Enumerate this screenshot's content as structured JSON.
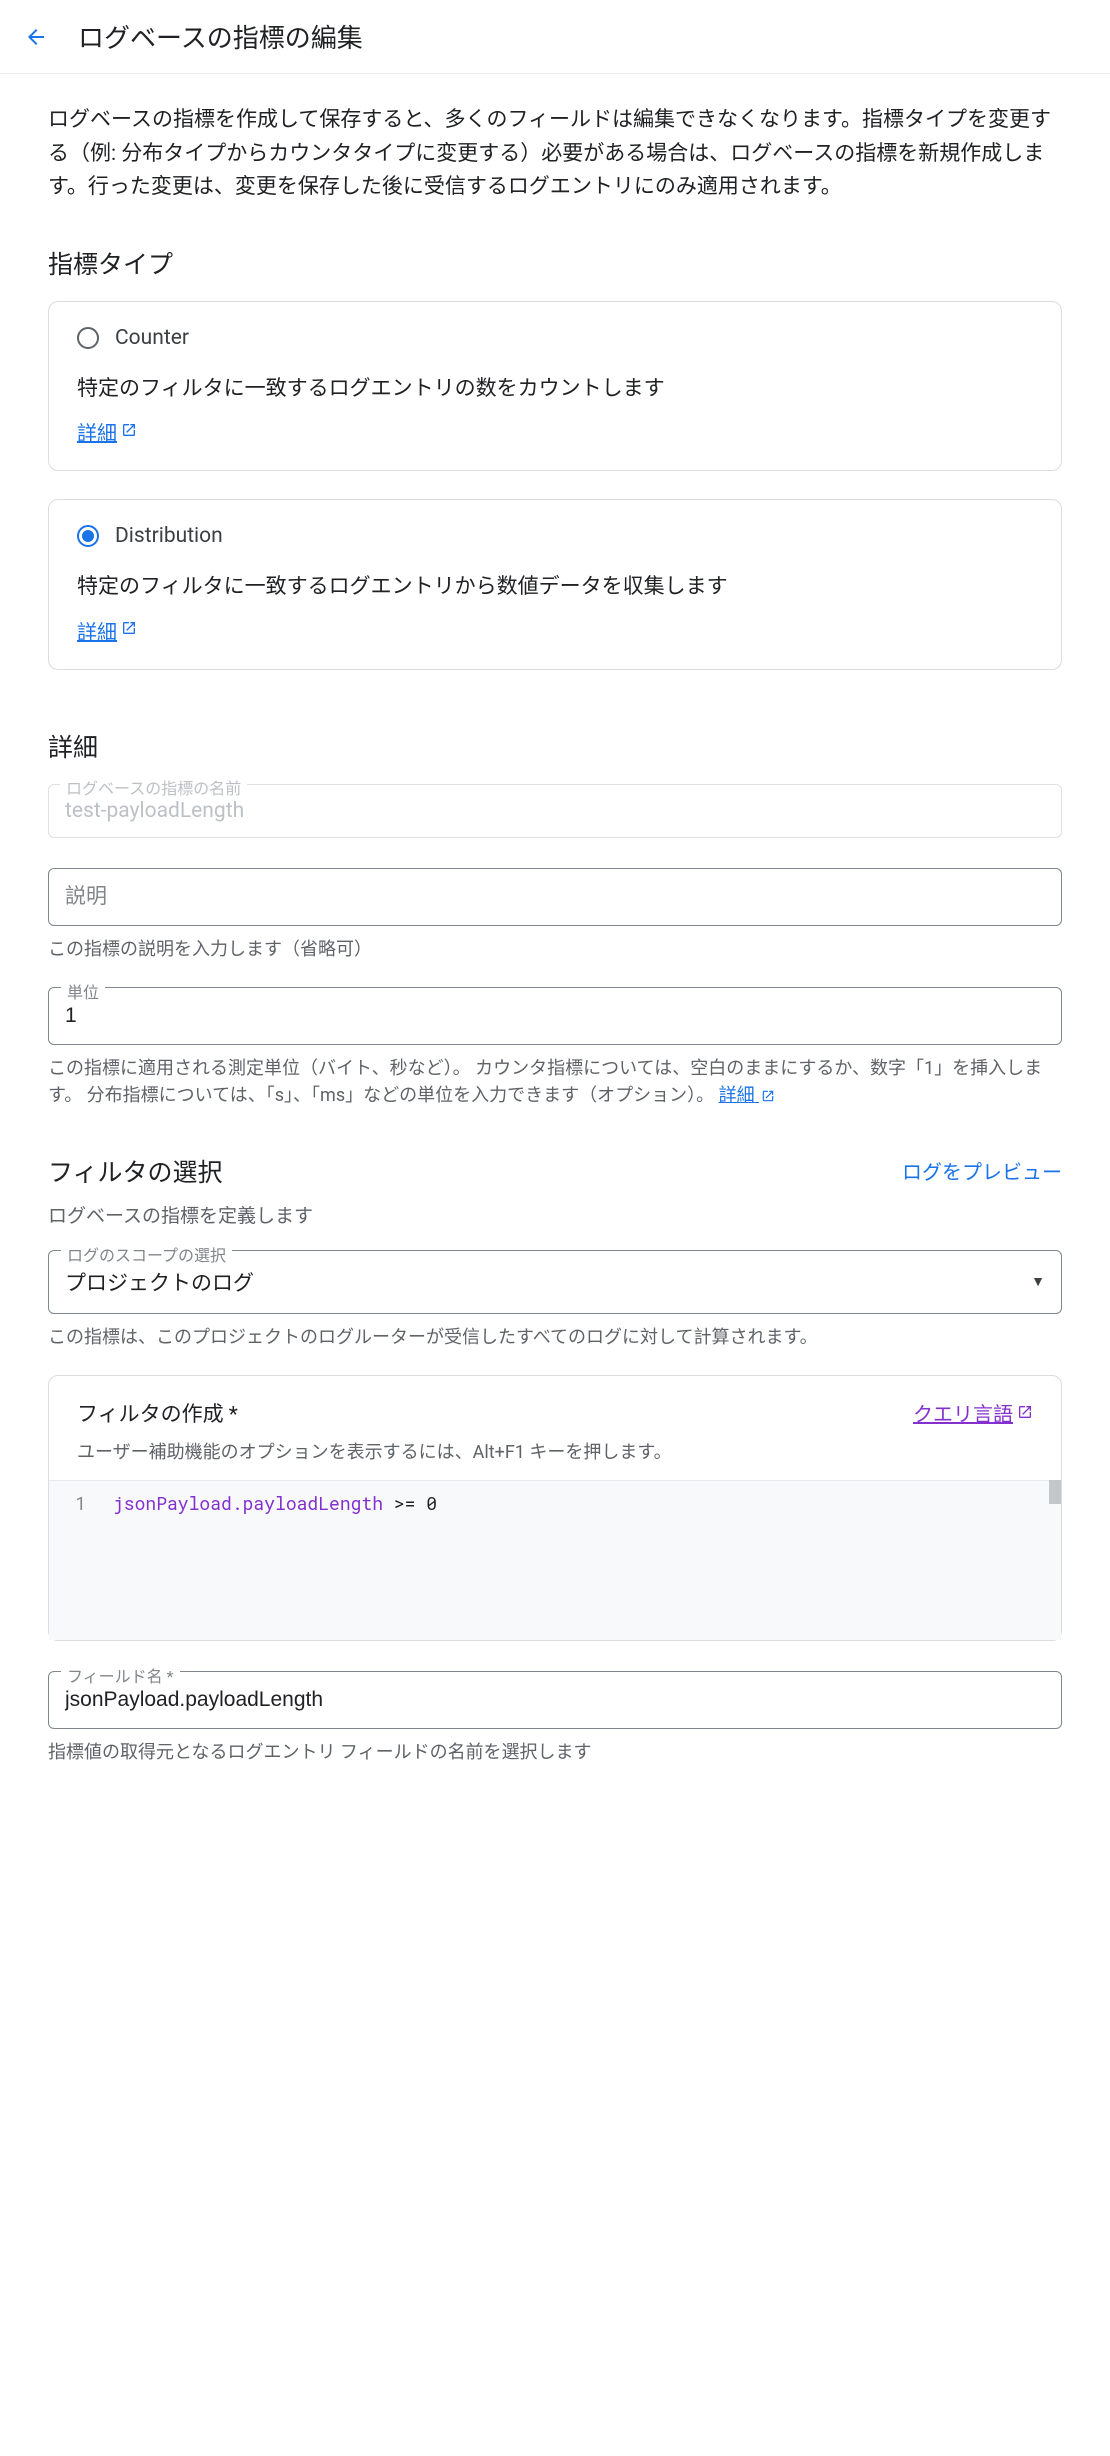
{
  "header": {
    "title": "ログベースの指標の編集"
  },
  "intro": "ログベースの指標を作成して保存すると、多くのフィールドは編集できなくなります。指標タイプを変更する（例: 分布タイプからカウンタタイプに変更する）必要がある場合は、ログベースの指標を新規作成します。行った変更は、変更を保存した後に受信するログエントリにのみ適用されます。",
  "metricType": {
    "heading": "指標タイプ",
    "counter": {
      "label": "Counter",
      "description": "特定のフィルタに一致するログエントリの数をカウントします",
      "detailLink": "詳細"
    },
    "distribution": {
      "label": "Distribution",
      "description": "特定のフィルタに一致するログエントリから数値データを収集します",
      "detailLink": "詳細"
    }
  },
  "details": {
    "heading": "詳細",
    "name": {
      "label": "ログベースの指標の名前",
      "value": "test-payloadLength"
    },
    "description": {
      "placeholder": "説明",
      "help": "この指標の説明を入力します（省略可）"
    },
    "units": {
      "label": "単位",
      "value": "1",
      "help": "この指標に適用される測定単位（バイト、秒など）。 カウンタ指標については、空白のままにするか、数字「1」を挿入します。 分布指標については、「s」、「ms」などの単位を入力できます（オプション）。",
      "detailLink": "詳細"
    }
  },
  "filter": {
    "heading": "フィルタの選択",
    "previewLink": "ログをプレビュー",
    "subtext": "ログベースの指標を定義します",
    "scope": {
      "label": "ログのスコープの選択",
      "value": "プロジェクトのログ",
      "help": "この指標は、このプロジェクトのログルーターが受信したすべてのログに対して計算されます。"
    },
    "editor": {
      "title": "フィルタの作成 *",
      "hint": "ユーザー補助機能のオプションを表示するには、Alt+F1 キーを押します。",
      "queryLangLink": "クエリ言語",
      "lineNumber": "1",
      "codeField": "jsonPayload.payloadLength",
      "codeRest": " >= 0"
    },
    "fieldName": {
      "label": "フィールド名 *",
      "value": "jsonPayload.payloadLength",
      "help": "指標値の取得元となるログエントリ フィールドの名前を選択します"
    }
  }
}
